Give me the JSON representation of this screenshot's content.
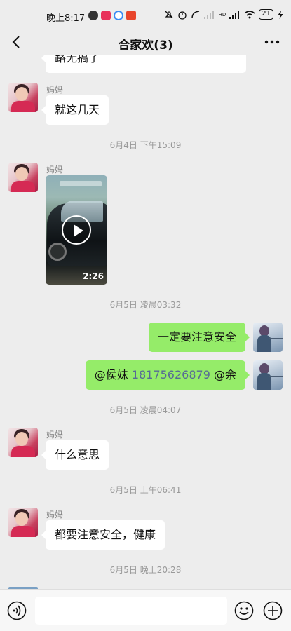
{
  "status_bar": {
    "time": "晚上8:17",
    "network_badge": "HD",
    "battery": "21"
  },
  "header": {
    "title": "合家欢(3)"
  },
  "messages": [
    {
      "type": "text",
      "direction": "incoming",
      "text": "路无搞了"
    },
    {
      "type": "text",
      "direction": "incoming",
      "sender": "妈妈",
      "text": "就这几天"
    },
    {
      "type": "timestamp",
      "text": "6月4日 下午15:09"
    },
    {
      "type": "video",
      "direction": "incoming",
      "sender": "妈妈",
      "duration": "2:26"
    },
    {
      "type": "timestamp",
      "text": "6月5日 凌晨03:32"
    },
    {
      "type": "text",
      "direction": "outgoing",
      "text": "一定要注意安全"
    },
    {
      "type": "mention",
      "direction": "outgoing",
      "mention": "@侯妹",
      "number": "18175626879",
      "mention2": "@余"
    },
    {
      "type": "timestamp",
      "text": "6月5日 凌晨04:07"
    },
    {
      "type": "text",
      "direction": "incoming",
      "sender": "妈妈",
      "text": "什么意思"
    },
    {
      "type": "timestamp",
      "text": "6月5日 上午06:41"
    },
    {
      "type": "text",
      "direction": "incoming",
      "sender": "妈妈",
      "text": "都要注意安全，健康"
    },
    {
      "type": "timestamp",
      "text": "6月5日 晚上20:28"
    }
  ],
  "input": {
    "value": "",
    "placeholder": ""
  },
  "icons": [
    "back-icon",
    "more-icon",
    "voice-icon",
    "emoji-icon",
    "plus-icon",
    "play-icon"
  ],
  "colors": {
    "background": "#ededed",
    "outgoing_bubble": "#95ec69",
    "incoming_bubble": "#ffffff",
    "mention_link": "#576b95"
  }
}
